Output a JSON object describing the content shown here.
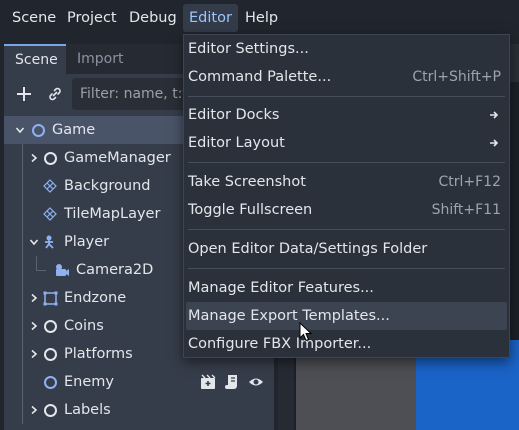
{
  "menubar": {
    "items": [
      {
        "label": "Scene",
        "active": false
      },
      {
        "label": "Project",
        "active": false
      },
      {
        "label": "Debug",
        "active": false
      },
      {
        "label": "Editor",
        "active": true
      },
      {
        "label": "Help",
        "active": false
      }
    ]
  },
  "dock": {
    "tabs": [
      {
        "label": "Scene",
        "active": true
      },
      {
        "label": "Import",
        "active": false
      }
    ],
    "filter_placeholder": "Filter: name, t:t",
    "tree": [
      {
        "label": "Game",
        "icon": "node-ring-blue-icon",
        "selected": true,
        "expanded": true
      },
      {
        "label": "GameManager",
        "icon": "node-ring-icon",
        "expanded": false
      },
      {
        "label": "Background",
        "icon": "tileset-icon"
      },
      {
        "label": "TileMapLayer",
        "icon": "tileset-icon"
      },
      {
        "label": "Player",
        "icon": "character-icon",
        "expanded": true
      },
      {
        "label": "Camera2D",
        "icon": "camera-icon"
      },
      {
        "label": "Endzone",
        "icon": "area-icon",
        "expanded": false
      },
      {
        "label": "Coins",
        "icon": "node-ring-icon",
        "expanded": false
      },
      {
        "label": "Platforms",
        "icon": "node-ring-icon",
        "expanded": false
      },
      {
        "label": "Enemy",
        "icon": "node-ring-blue-icon"
      },
      {
        "label": "Labels",
        "icon": "node-ring-icon",
        "expanded": false
      }
    ]
  },
  "editor_menu": {
    "items": [
      {
        "label": "Editor Settings...",
        "shortcut": "",
        "submenu": false,
        "hover": false
      },
      {
        "label": "Command Palette...",
        "shortcut": "Ctrl+Shift+P",
        "submenu": false,
        "hover": false
      },
      {
        "label": "Editor Docks",
        "shortcut": "",
        "submenu": true,
        "hover": false
      },
      {
        "label": "Editor Layout",
        "shortcut": "",
        "submenu": true,
        "hover": false
      },
      {
        "label": "Take Screenshot",
        "shortcut": "Ctrl+F12",
        "submenu": false,
        "hover": false
      },
      {
        "label": "Toggle Fullscreen",
        "shortcut": "Shift+F11",
        "submenu": false,
        "hover": false
      },
      {
        "label": "Open Editor Data/Settings Folder",
        "shortcut": "",
        "submenu": false,
        "hover": false
      },
      {
        "label": "Manage Editor Features...",
        "shortcut": "",
        "submenu": false,
        "hover": false
      },
      {
        "label": "Manage Export Templates...",
        "shortcut": "",
        "submenu": false,
        "hover": true
      },
      {
        "label": "Configure FBX Importer...",
        "shortcut": "",
        "submenu": false,
        "hover": false
      }
    ]
  },
  "colors": {
    "accent": "#7aa5e8",
    "menu_active_text": "#9cc4ff",
    "node_blue": "#8fb1f2"
  }
}
